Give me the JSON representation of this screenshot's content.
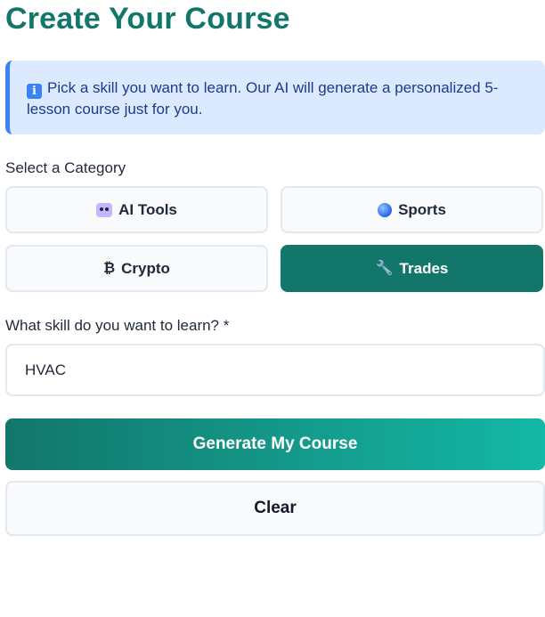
{
  "page": {
    "title": "Create Your Course"
  },
  "info": {
    "icon": "info-icon",
    "icon_glyph": "i",
    "text": "Pick a skill you want to learn. Our AI will generate a personalized 5-lesson course just for you."
  },
  "category": {
    "label": "Select a Category",
    "selected": "Trades",
    "options": [
      {
        "label": "AI Tools",
        "icon": "robot-icon"
      },
      {
        "label": "Sports",
        "icon": "globe-icon"
      },
      {
        "label": "Crypto",
        "icon": "bitcoin-icon",
        "glyph": "₿"
      },
      {
        "label": "Trades",
        "icon": "wrench-icon",
        "glyph": "🔧"
      }
    ]
  },
  "skill": {
    "label": "What skill do you want to learn? *",
    "value": "HVAC"
  },
  "actions": {
    "generate_label": "Generate My Course",
    "clear_label": "Clear"
  },
  "colors": {
    "accent": "#13766b",
    "accent_light": "#14b8a6",
    "info_bg": "#dbeafe",
    "info_border": "#3b82f6"
  }
}
